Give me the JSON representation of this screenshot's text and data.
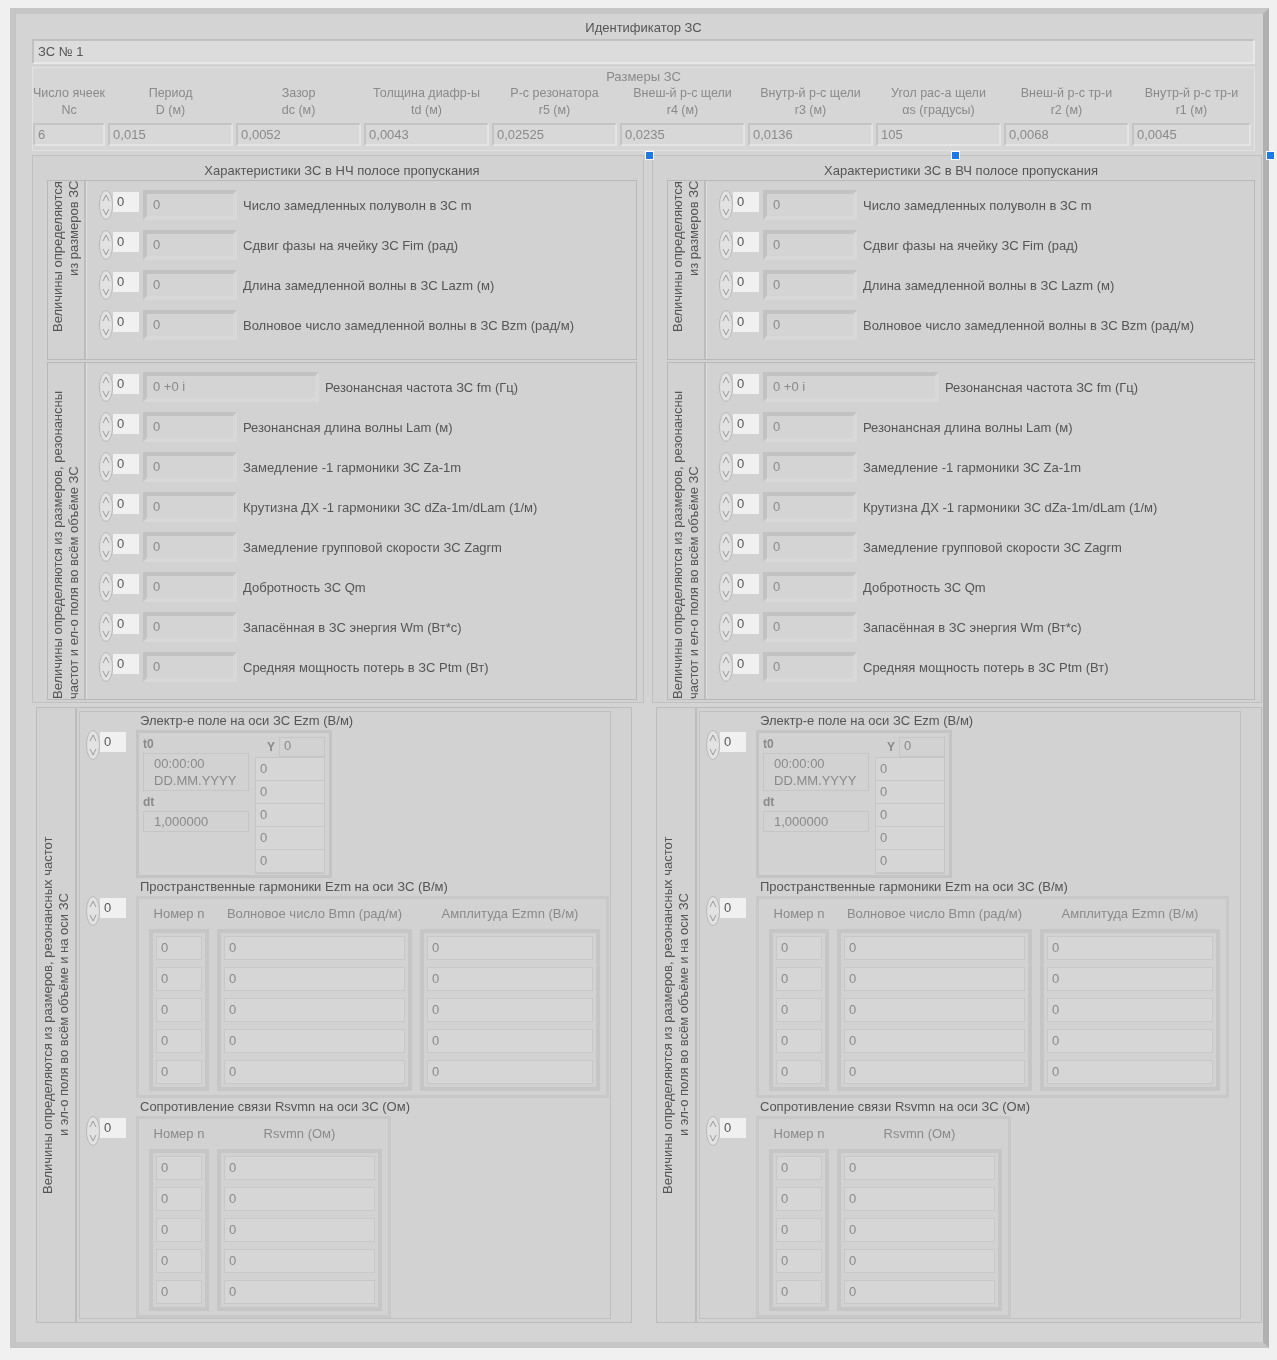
{
  "identifier": {
    "title": "Идентификатор ЗС",
    "value": "ЗС № 1"
  },
  "sizes": {
    "title": "Размеры ЗС",
    "columns": [
      {
        "label": "Число ячеек",
        "unit": "Nc",
        "value": "6"
      },
      {
        "label": "Период",
        "unit": "D (м)",
        "value": "0,015"
      },
      {
        "label": "Зазор",
        "unit": "dc (м)",
        "value": "0,0052"
      },
      {
        "label": "Толщина диафр-ы",
        "unit": "td (м)",
        "value": "0,0043"
      },
      {
        "label": "Р-с резонатора",
        "unit": "r5 (м)",
        "value": "0,02525"
      },
      {
        "label": "Внеш-й р-с щели",
        "unit": "r4 (м)",
        "value": "0,0235"
      },
      {
        "label": "Внутр-й р-с щели",
        "unit": "r3 (м)",
        "value": "0,0136"
      },
      {
        "label": "Угол рас-а щели",
        "unit": "αs (градусы)",
        "value": "105"
      },
      {
        "label": "Внеш-й р-с тр-и",
        "unit": "r2 (м)",
        "value": "0,0068"
      },
      {
        "label": "Внутр-й р-с тр-и",
        "unit": "r1 (м)",
        "value": "0,0045"
      }
    ]
  },
  "bands": [
    {
      "title": "Характеристики ЗС в НЧ полосе пропускания",
      "geometry_group": {
        "caption_lines": [
          "Величины определяются",
          "из размеров ЗС"
        ],
        "rows": [
          {
            "kind": "real",
            "index": "0",
            "value": "0",
            "label": "Число замедленных полуволн в ЗС m"
          },
          {
            "kind": "real",
            "index": "0",
            "value": "0",
            "label": "Сдвиг фазы на ячейку ЗС Fim (рад)"
          },
          {
            "kind": "real",
            "index": "0",
            "value": "0",
            "label": "Длина замедленной волны в ЗС Lazm (м)"
          },
          {
            "kind": "real",
            "index": "0",
            "value": "0",
            "label": "Волновое число замедленной волны в ЗС Bzm (рад/м)"
          }
        ]
      },
      "resonance_group": {
        "caption_lines": [
          "Величины определяются из размеров, резонансны",
          "частот и ел-о поля во всём объёме ЗС"
        ],
        "rows": [
          {
            "kind": "complex",
            "index": "0",
            "value": "0 +0 i",
            "label": "Резонансная частота ЗС fm (Гц)"
          },
          {
            "kind": "real",
            "index": "0",
            "value": "0",
            "label": "Резонансная длина волны Lam (м)"
          },
          {
            "kind": "real",
            "index": "0",
            "value": "0",
            "label": "Замедление -1 гармоники ЗС Za-1m"
          },
          {
            "kind": "real",
            "index": "0",
            "value": "0",
            "label": "Крутизна ДХ -1 гармоники ЗС dZa-1m/dLam (1/м)"
          },
          {
            "kind": "real",
            "index": "0",
            "value": "0",
            "label": "Замедление групповой скорости ЗС Zagrm"
          },
          {
            "kind": "real",
            "index": "0",
            "value": "0",
            "label": "Добротность ЗС Qm"
          },
          {
            "kind": "real",
            "index": "0",
            "value": "0",
            "label": "Запасённая в ЗС энергия Wm (Вт*с)"
          },
          {
            "kind": "real",
            "index": "0",
            "value": "0",
            "label": "Средняя мощность потерь в ЗС Ptm (Вт)"
          }
        ]
      },
      "field_group": {
        "caption_lines": [
          "Величины определяются из размеров, резонансных частот",
          "и эл-о поля во всём объёме и на оси ЗС"
        ],
        "ezm": {
          "title": "Электр-е поле на оси ЗС Ezm (В/м)",
          "index": "0",
          "t0_label": "t0",
          "t0_lines": [
            "00:00:00",
            "DD.MM.YYYY"
          ],
          "dt_label": "dt",
          "dt_value": "1,000000",
          "y_label": "Y",
          "y_index": "0",
          "y_values": [
            "0",
            "0",
            "0",
            "0",
            "0"
          ]
        },
        "harmonics": {
          "title": "Пространственные гармоники Ezm на оси ЗС (В/м)",
          "index": "0",
          "columns": [
            "Номер n",
            "Волновое число Bmn (рад/м)",
            "Амплитуда Ezmn (В/м)"
          ],
          "rows": [
            [
              "0",
              "0",
              "0"
            ],
            [
              "0",
              "0",
              "0"
            ],
            [
              "0",
              "0",
              "0"
            ],
            [
              "0",
              "0",
              "0"
            ],
            [
              "0",
              "0",
              "0"
            ]
          ]
        },
        "coupling": {
          "title": "Сопротивление связи Rsvmn на оси ЗС (Ом)",
          "index": "0",
          "columns": [
            "Номер n",
            "Rsvmn (Ом)"
          ],
          "rows": [
            [
              "0",
              "0"
            ],
            [
              "0",
              "0"
            ],
            [
              "0",
              "0"
            ],
            [
              "0",
              "0"
            ],
            [
              "0",
              "0"
            ]
          ]
        }
      }
    },
    {
      "title": "Характеристики ЗС в ВЧ полосе пропускания",
      "geometry_group": {
        "caption_lines": [
          "Величины определяются",
          "из размеров ЗС"
        ],
        "rows": [
          {
            "kind": "real",
            "index": "0",
            "value": "0",
            "label": "Число замедленных полуволн в ЗС m"
          },
          {
            "kind": "real",
            "index": "0",
            "value": "0",
            "label": "Сдвиг фазы на ячейку ЗС Fim (рад)"
          },
          {
            "kind": "real",
            "index": "0",
            "value": "0",
            "label": "Длина замедленной волны в ЗС Lazm (м)"
          },
          {
            "kind": "real",
            "index": "0",
            "value": "0",
            "label": "Волновое число замедленной волны в ЗС Bzm (рад/м)"
          }
        ]
      },
      "resonance_group": {
        "caption_lines": [
          "Величины определяются из размеров, резонансны",
          "частот и ел-о поля во всём объёме ЗС"
        ],
        "rows": [
          {
            "kind": "complex",
            "index": "0",
            "value": "0 +0 i",
            "label": "Резонансная частота ЗС fm (Гц)"
          },
          {
            "kind": "real",
            "index": "0",
            "value": "0",
            "label": "Резонансная длина волны Lam (м)"
          },
          {
            "kind": "real",
            "index": "0",
            "value": "0",
            "label": "Замедление -1 гармоники ЗС Za-1m"
          },
          {
            "kind": "real",
            "index": "0",
            "value": "0",
            "label": "Крутизна ДХ -1 гармоники ЗС dZa-1m/dLam (1/м)"
          },
          {
            "kind": "real",
            "index": "0",
            "value": "0",
            "label": "Замедление групповой скорости ЗС Zagrm"
          },
          {
            "kind": "real",
            "index": "0",
            "value": "0",
            "label": "Добротность ЗС Qm"
          },
          {
            "kind": "real",
            "index": "0",
            "value": "0",
            "label": "Запасённая в ЗС энергия Wm (Вт*с)"
          },
          {
            "kind": "real",
            "index": "0",
            "value": "0",
            "label": "Средняя мощность потерь в ЗС Ptm (Вт)"
          }
        ]
      },
      "field_group": {
        "caption_lines": [
          "Величины определяются из размеров, резонансных частот",
          "и эл-о поля во всём объёме и на оси ЗС"
        ],
        "ezm": {
          "title": "Электр-е поле на оси ЗС Ezm (В/м)",
          "index": "0",
          "t0_label": "t0",
          "t0_lines": [
            "00:00:00",
            "DD.MM.YYYY"
          ],
          "dt_label": "dt",
          "dt_value": "1,000000",
          "y_label": "Y",
          "y_index": "0",
          "y_values": [
            "0",
            "0",
            "0",
            "0",
            "0"
          ]
        },
        "harmonics": {
          "title": "Пространственные гармоники Ezm на оси ЗС (В/м)",
          "index": "0",
          "columns": [
            "Номер n",
            "Волновое число Bmn (рад/м)",
            "Амплитуда Ezmn (В/м)"
          ],
          "rows": [
            [
              "0",
              "0",
              "0"
            ],
            [
              "0",
              "0",
              "0"
            ],
            [
              "0",
              "0",
              "0"
            ],
            [
              "0",
              "0",
              "0"
            ],
            [
              "0",
              "0",
              "0"
            ]
          ]
        },
        "coupling": {
          "title": "Сопротивление связи Rsvmn на оси ЗС (Ом)",
          "index": "0",
          "columns": [
            "Номер n",
            "Rsvmn (Ом)"
          ],
          "rows": [
            [
              "0",
              "0"
            ],
            [
              "0",
              "0"
            ],
            [
              "0",
              "0"
            ],
            [
              "0",
              "0"
            ],
            [
              "0",
              "0"
            ]
          ]
        }
      }
    }
  ]
}
